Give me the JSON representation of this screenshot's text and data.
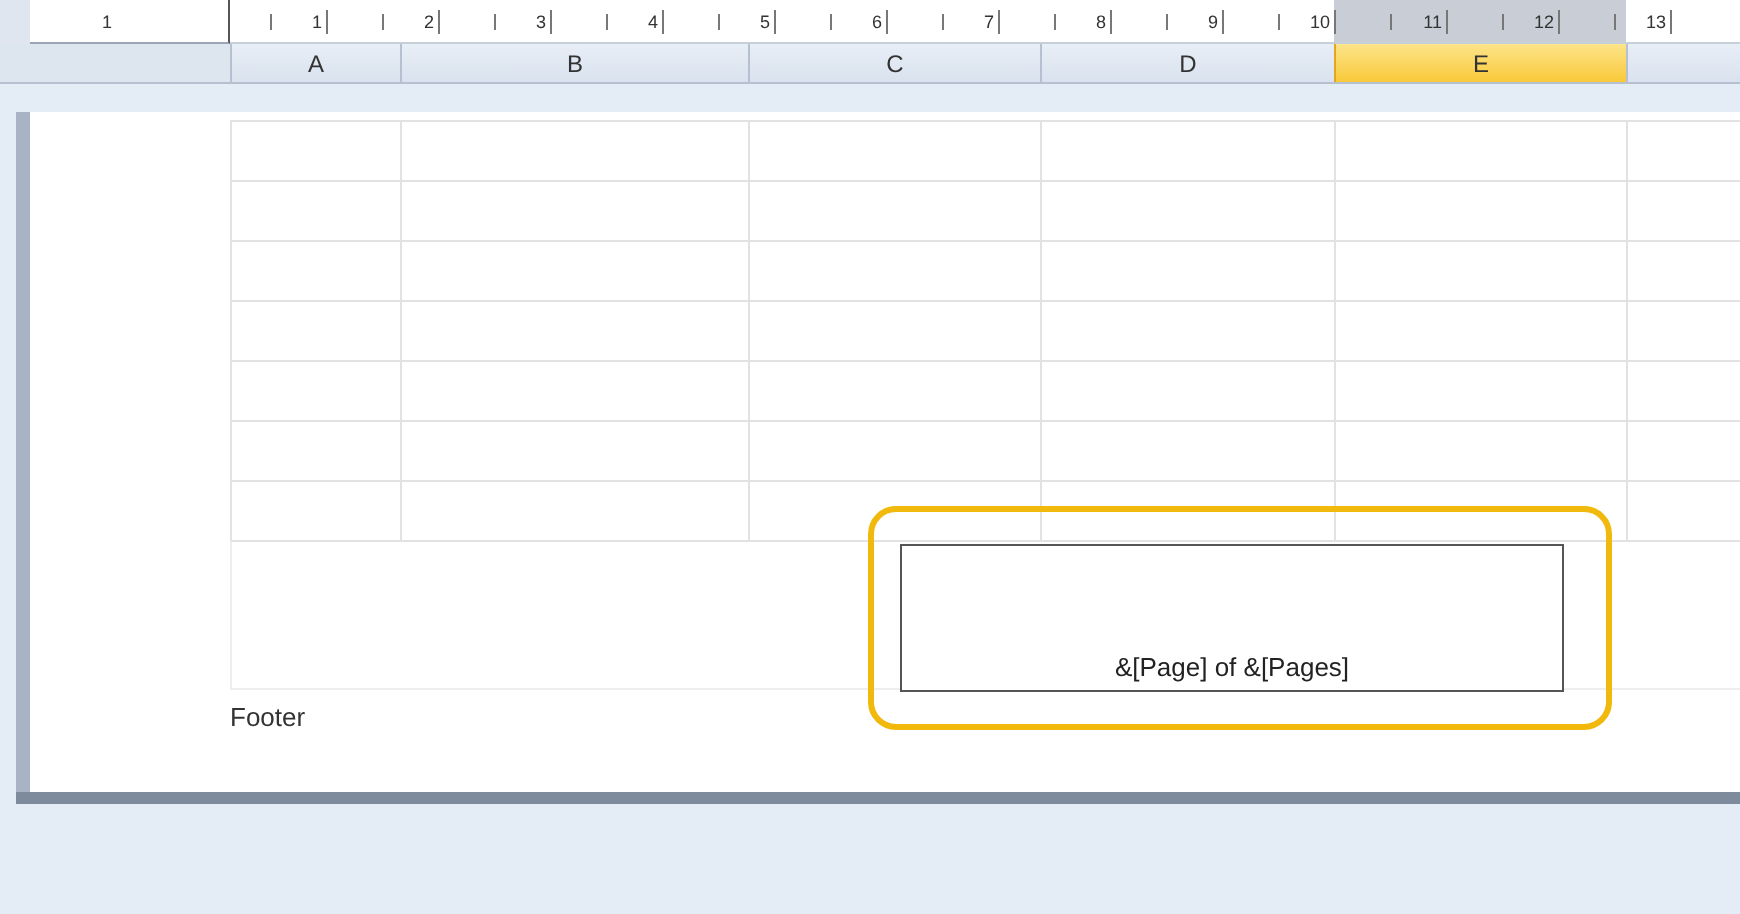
{
  "ruler": {
    "left_label": "1",
    "labels": [
      "1",
      "2",
      "3",
      "4",
      "5",
      "6",
      "7",
      "8",
      "9",
      "10",
      "11",
      "12",
      "13"
    ]
  },
  "columns": [
    {
      "label": "A",
      "selected": false
    },
    {
      "label": "B",
      "selected": false
    },
    {
      "label": "C",
      "selected": false
    },
    {
      "label": "D",
      "selected": false
    },
    {
      "label": "E",
      "selected": true
    }
  ],
  "footer": {
    "label": "Footer",
    "center_section": "&[Page] of &[Pages]",
    "highlighted": true
  }
}
